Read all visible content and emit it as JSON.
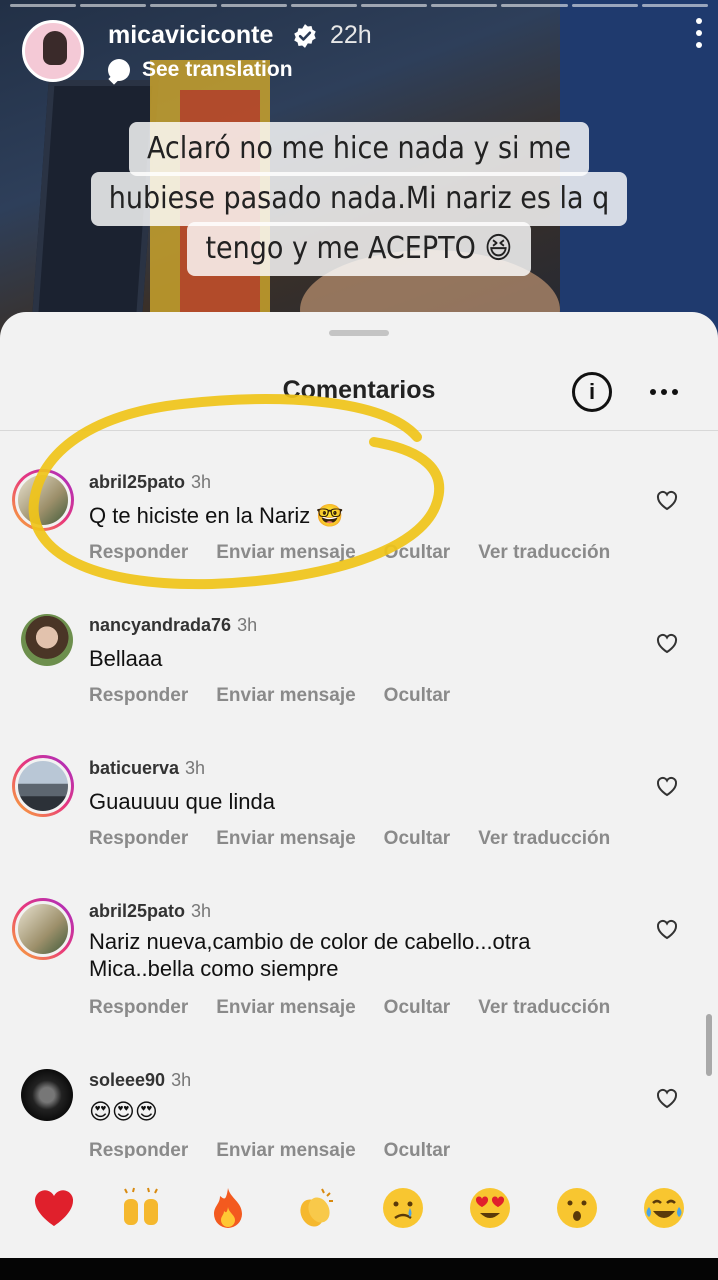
{
  "story": {
    "username": "micaviciconte",
    "time_ago": "22h",
    "see_translation": "See translation",
    "caption_lines": [
      "Aclaró no me hice nada y si me",
      "hubiese pasado nada.Mi nariz es la q",
      "tengo y me ACEPTO 😆"
    ]
  },
  "sheet": {
    "title": "Comentarios",
    "info_glyph": "i"
  },
  "comments": [
    {
      "username": "abril25pato",
      "time": "3h",
      "text": "Q te hiciste en la Nariz 🤓",
      "actions": [
        "Responder",
        "Enviar mensaje",
        "Ocultar",
        "Ver traducción"
      ]
    },
    {
      "username": "nancyandrada76",
      "time": "3h",
      "text": "Bellaaa",
      "actions": [
        "Responder",
        "Enviar mensaje",
        "Ocultar"
      ]
    },
    {
      "username": "baticuerva",
      "time": "3h",
      "text": "Guauuuu que linda",
      "actions": [
        "Responder",
        "Enviar mensaje",
        "Ocultar",
        "Ver traducción"
      ]
    },
    {
      "username": "abril25pato",
      "time": "3h",
      "text": "Nariz nueva,cambio de color de cabello...otra Mica..bella como siempre",
      "actions": [
        "Responder",
        "Enviar mensaje",
        "Ocultar",
        "Ver traducción"
      ]
    },
    {
      "username": "soleee90",
      "time": "3h",
      "text": "😍😍😍",
      "actions": [
        "Responder",
        "Enviar mensaje",
        "Ocultar"
      ]
    }
  ],
  "reactions": [
    "heart",
    "raised-hands",
    "fire",
    "clapping-hands",
    "crying-face",
    "heart-eyes-face",
    "surprised-face",
    "tears-of-joy-face"
  ],
  "colors": {
    "highlight": "#f0c419",
    "sheet_bg": "#f2f2f2",
    "action_text": "#8a8a8a"
  }
}
